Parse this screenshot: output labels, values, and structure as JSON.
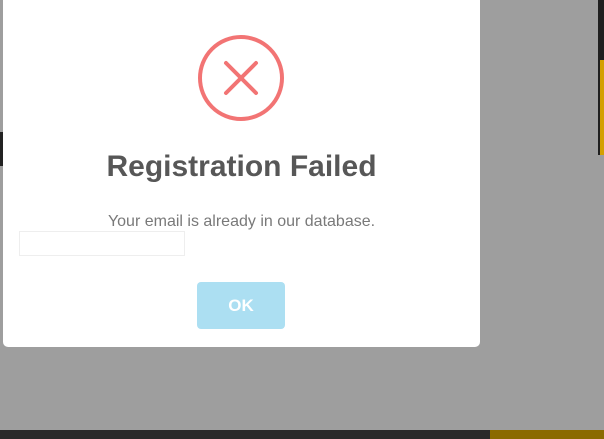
{
  "dialog": {
    "title": "Registration Failed",
    "message": "Your email is already in our database.",
    "ok_label": "OK",
    "icon": "error-x-icon"
  },
  "colors": {
    "overlay": "#9e9e9e",
    "dialog_bg": "#ffffff",
    "icon_stroke": "#f27474",
    "title_text": "#575757",
    "message_text": "#797979",
    "button_bg": "#acdff2",
    "button_text": "#ffffff"
  }
}
